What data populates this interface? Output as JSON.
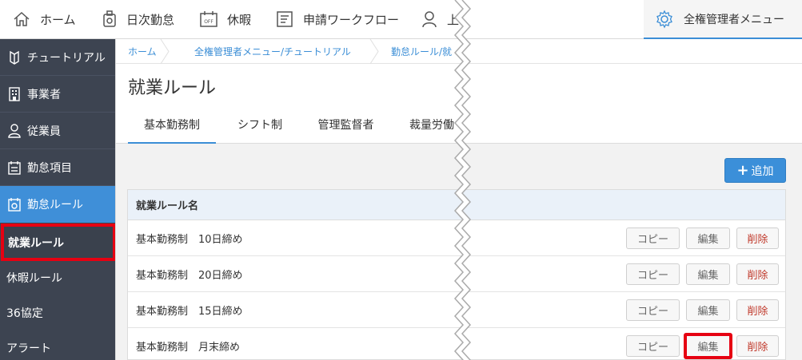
{
  "topnav": {
    "items": [
      {
        "label": "ホーム",
        "icon": "home-icon"
      },
      {
        "label": "日次勤怠",
        "icon": "timecard-icon"
      },
      {
        "label": "休暇",
        "icon": "calendar-off-icon"
      },
      {
        "label": "申請ワークフロー",
        "icon": "workflow-icon"
      },
      {
        "label": "上",
        "icon": "user-icon"
      }
    ],
    "admin_label": "全権管理者メニュー"
  },
  "sidebar": {
    "items": [
      {
        "label": "チュートリアル",
        "icon": "tutorial-icon"
      },
      {
        "label": "事業者",
        "icon": "building-icon"
      },
      {
        "label": "従業員",
        "icon": "person-icon"
      },
      {
        "label": "勤怠項目",
        "icon": "list-icon"
      },
      {
        "label": "勤怠ルール",
        "icon": "calendar-rule-icon"
      }
    ],
    "subitems": [
      {
        "label": "就業ルール"
      },
      {
        "label": "休暇ルール"
      },
      {
        "label": "36協定"
      },
      {
        "label": "アラート"
      }
    ]
  },
  "breadcrumb": [
    "ホーム",
    "全権管理者メニュー/チュートリアル",
    "勤怠ルール/就"
  ],
  "page": {
    "title": "就業ルール",
    "tabs": [
      "基本勤務制",
      "シフト制",
      "管理監督者",
      "裁量労働"
    ]
  },
  "add_button": "追加",
  "table": {
    "header": "就業ルール名",
    "rows": [
      {
        "name": "基本勤務制　10日締め"
      },
      {
        "name": "基本勤務制　20日締め"
      },
      {
        "name": "基本勤務制　15日締め"
      },
      {
        "name": "基本勤務制　月末締め"
      }
    ],
    "copy_label": "コピー",
    "edit_label": "編集",
    "delete_label": "削除"
  },
  "colors": {
    "accent": "#3b8ed6",
    "sidebar_bg": "#3d4451",
    "highlight": "#e60012",
    "delete": "#c0392b"
  }
}
